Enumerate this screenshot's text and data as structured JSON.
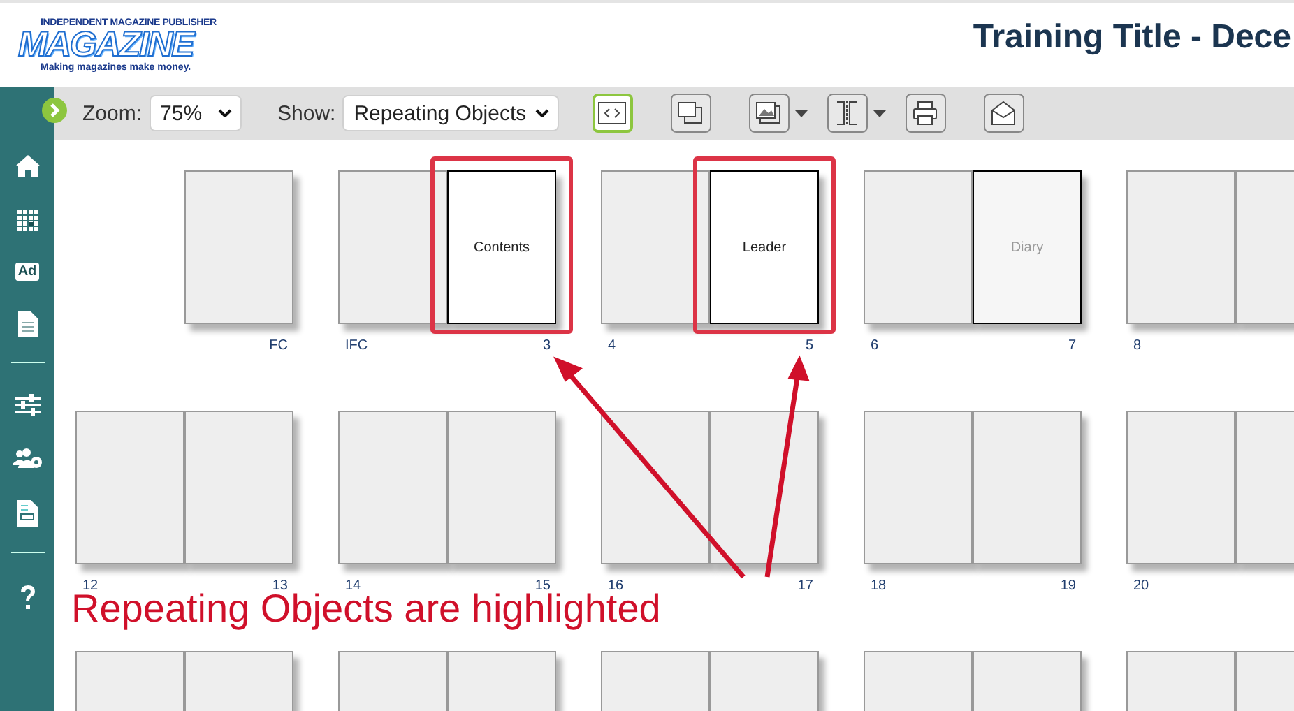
{
  "header": {
    "logo": {
      "top_line": "INDEPENDENT MAGAZINE PUBLISHER",
      "wordmark": "MAGAZINE",
      "slogan": "Making magazines make money."
    },
    "title": "Training Title - Dece"
  },
  "sidebar": {
    "ad_badge": "Ad"
  },
  "toolbar": {
    "zoom_label": "Zoom:",
    "zoom_value": "75%",
    "show_label": "Show:",
    "show_value": "Repeating Objects",
    "buttons": [
      {
        "selected": true,
        "dropdown": false
      },
      {
        "selected": false,
        "dropdown": false
      },
      {
        "selected": false,
        "dropdown": true
      },
      {
        "selected": false,
        "dropdown": true
      },
      {
        "selected": false,
        "dropdown": false
      },
      {
        "selected": false,
        "dropdown": false
      }
    ]
  },
  "rows": [
    {
      "spreads": [
        {
          "right": {
            "kind": "blank"
          },
          "right_number": "FC"
        },
        {
          "left": {
            "kind": "blank"
          },
          "right": {
            "kind": "repeating",
            "text": "Contents",
            "annotated": true
          },
          "left_number": "IFC",
          "right_number": "3"
        },
        {
          "left": {
            "kind": "blank"
          },
          "right": {
            "kind": "repeating",
            "text": "Leader",
            "annotated": true
          },
          "left_number": "4",
          "right_number": "5"
        },
        {
          "left": {
            "kind": "blank"
          },
          "right": {
            "kind": "faded",
            "text": "Diary"
          },
          "left_number": "6",
          "right_number": "7"
        },
        {
          "left": {
            "kind": "blank"
          },
          "right": {
            "kind": "blank"
          },
          "left_number": "8"
        }
      ]
    },
    {
      "spreads": [
        {
          "left": {
            "kind": "blank"
          },
          "right": {
            "kind": "blank"
          },
          "left_number": "12",
          "right_number": "13"
        },
        {
          "left": {
            "kind": "blank"
          },
          "right": {
            "kind": "blank"
          },
          "left_number": "14",
          "right_number": "15"
        },
        {
          "left": {
            "kind": "blank"
          },
          "right": {
            "kind": "blank"
          },
          "left_number": "16",
          "right_number": "17"
        },
        {
          "left": {
            "kind": "blank"
          },
          "right": {
            "kind": "blank"
          },
          "left_number": "18",
          "right_number": "19"
        },
        {
          "left": {
            "kind": "blank"
          },
          "right": {
            "kind": "blank"
          },
          "left_number": "20"
        }
      ]
    },
    {
      "spreads": [
        {
          "left": {
            "kind": "blank"
          },
          "right": {
            "kind": "blank"
          }
        },
        {
          "left": {
            "kind": "blank"
          },
          "right": {
            "kind": "blank"
          }
        },
        {
          "left": {
            "kind": "blank"
          },
          "right": {
            "kind": "blank"
          }
        },
        {
          "left": {
            "kind": "blank"
          },
          "right": {
            "kind": "blank"
          }
        },
        {
          "left": {
            "kind": "blank"
          },
          "right": {
            "kind": "blank"
          }
        }
      ]
    }
  ],
  "annotation": {
    "caption": "Repeating Objects are highlighted"
  }
}
